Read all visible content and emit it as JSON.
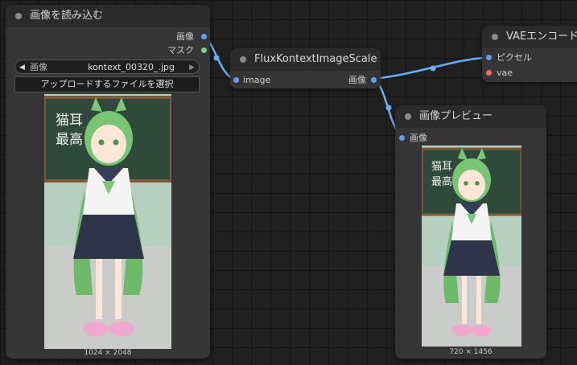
{
  "load_image": {
    "title": "画像を読み込む",
    "out_image": "画像",
    "out_mask": "マスク",
    "combo_label": "画像",
    "combo_value": "kontext_00320_.jpg",
    "upload_button": "アップロードするファイルを選択",
    "board_text_1": "猫耳",
    "board_text_2": "最高!",
    "size_caption": "1024 × 2048"
  },
  "scale_node": {
    "title": "FluxKontextImageScale",
    "in_image": "image",
    "out_image": "画像"
  },
  "vae_node": {
    "title": "VAEエンコード",
    "in_pixels": "ピクセル",
    "in_vae": "vae"
  },
  "preview_node": {
    "title": "画像プレビュー",
    "in_image": "画像",
    "board_text_1": "猫耳",
    "board_text_2": "最高!",
    "size_caption": "720 × 1456"
  },
  "colors": {
    "image_port": "#5fa0f0",
    "mask_port": "#7ecf8a",
    "vae_port": "#f06a6a",
    "link": "#6aaef0"
  }
}
